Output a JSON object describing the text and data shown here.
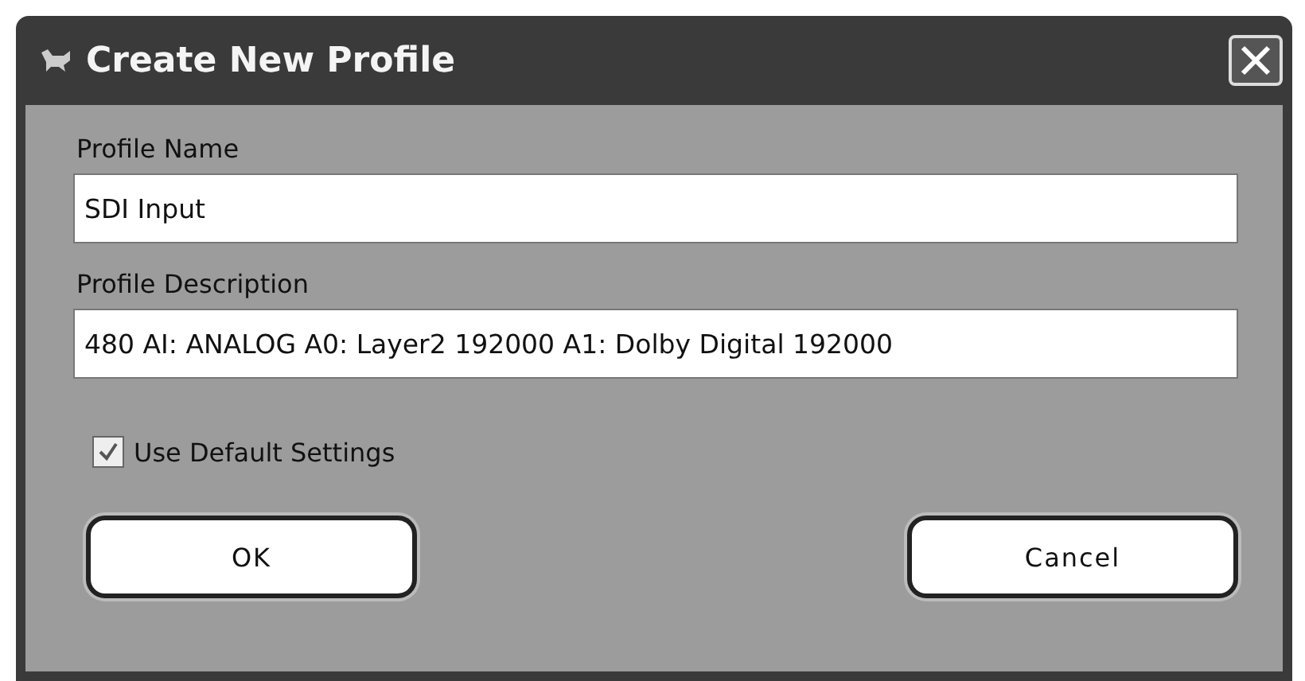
{
  "window": {
    "title": "Create New Profile"
  },
  "fields": [
    {
      "label": "Profile Name",
      "value": "SDI Input"
    },
    {
      "label": "Profile Description",
      "value": "480 AI: ANALOG A0: Layer2 192000 A1: Dolby Digital 192000"
    }
  ],
  "checkbox": {
    "label": "Use Default Settings",
    "checked": true
  },
  "buttons": [
    {
      "label": "OK"
    },
    {
      "label": "Cancel"
    }
  ]
}
